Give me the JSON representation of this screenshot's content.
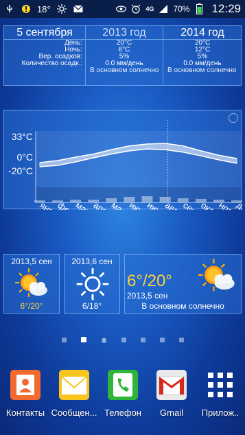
{
  "status_bar": {
    "temperature": "18°",
    "network": "4G",
    "battery_percent": "70%",
    "time": "12:29"
  },
  "table_widget": {
    "date_header": "5 сентября",
    "year1_header": "2013 год",
    "year2_header": "2014 год",
    "rows": [
      {
        "label": "День:",
        "v1": "20°C",
        "v2": "20°C"
      },
      {
        "label": "Ночь:",
        "v1": "6°C",
        "v2": "12°C"
      },
      {
        "label": "Вер. осадков:",
        "v1": "5%",
        "v2": "5%"
      },
      {
        "label": "Количество осадк..",
        "v1": "0.0 мм/день",
        "v2": "0.0 мм/день"
      }
    ],
    "desc1": "В основном солнечно",
    "desc2": "В основном солнечно"
  },
  "chart_data": {
    "type": "area",
    "ylabels": [
      "33°C",
      "0°C",
      "-20°C"
    ],
    "ylabel_values": [
      33,
      0,
      -20
    ],
    "months": [
      "янв",
      "фев",
      "мар",
      "апр",
      "мая",
      "июн",
      "июл",
      "авг",
      "сен",
      "окт",
      "ноя",
      "дек"
    ],
    "series": [
      {
        "name": "high",
        "values": [
          -8,
          -5,
          0,
          5,
          12,
          18,
          21,
          22,
          18,
          10,
          3,
          -2
        ]
      },
      {
        "name": "low",
        "values": [
          -14,
          -12,
          -7,
          -1,
          5,
          10,
          13,
          12,
          8,
          2,
          -4,
          -9
        ]
      }
    ],
    "precip_values": [
      3,
      3,
      4,
      4,
      6,
      8,
      9,
      8,
      6,
      5,
      4,
      3
    ]
  },
  "widget_small1": {
    "date": "2013,5 сен",
    "temp": "6°/20°"
  },
  "widget_small2": {
    "date": "2013,6 сен",
    "temp": "6/18°"
  },
  "widget_big": {
    "temp": "6°/20°",
    "date": "2013,5 сен",
    "desc": "В основном солнечно"
  },
  "dock": [
    {
      "label": "Контакты",
      "color": "#f26a2e"
    },
    {
      "label": "Сообщен...",
      "color": "#f7c51e"
    },
    {
      "label": "Телефон",
      "color": "#2fb53a"
    },
    {
      "label": "Gmail",
      "color": "#ffffff"
    },
    {
      "label": "Прилож..",
      "color": "#ffffff"
    }
  ]
}
